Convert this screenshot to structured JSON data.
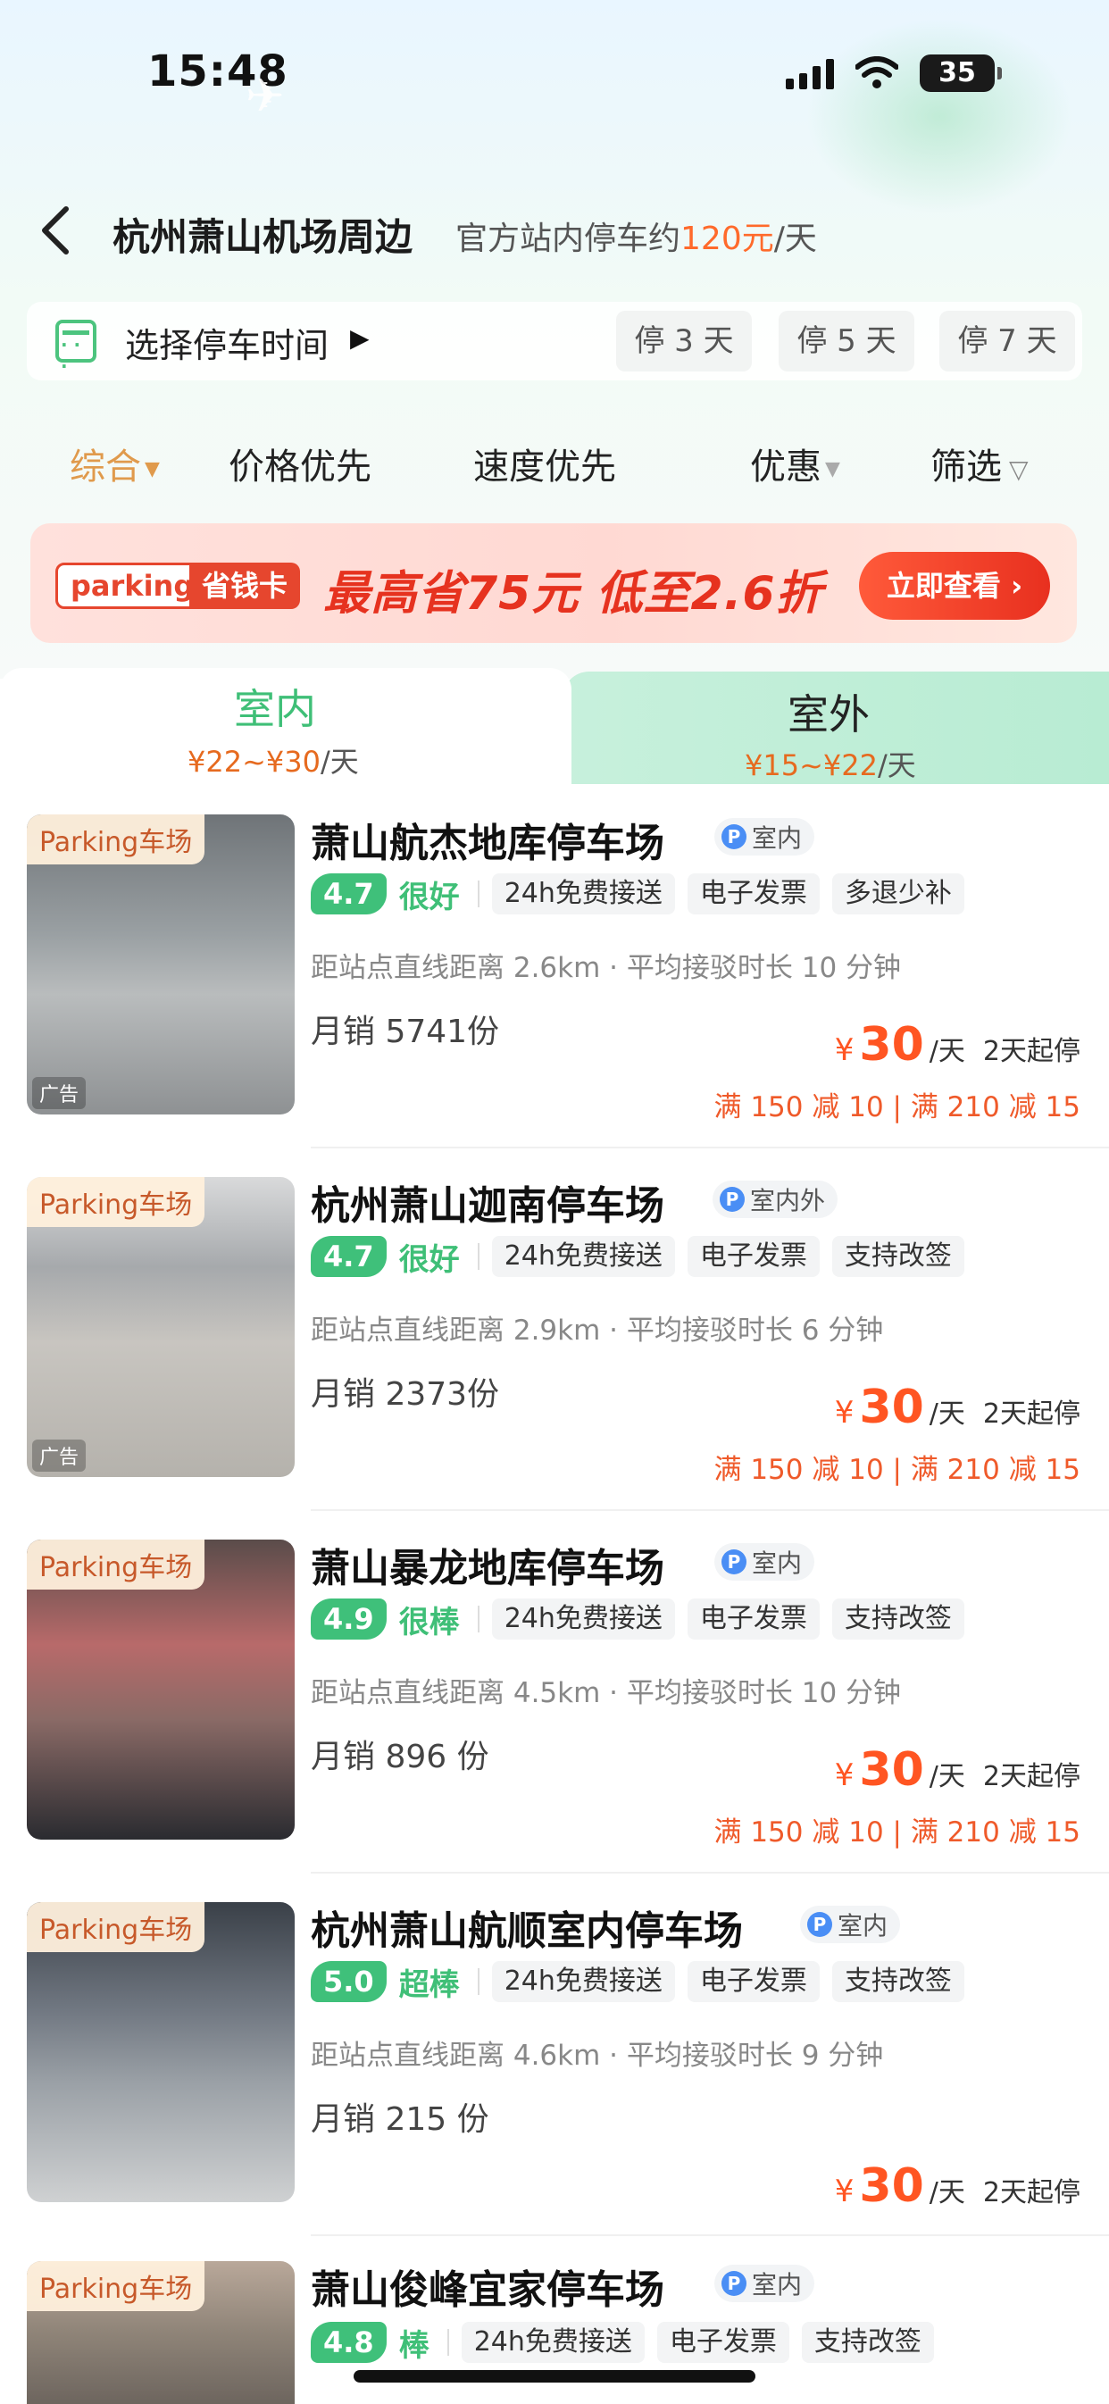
{
  "status": {
    "time": "15:48",
    "battery": "35"
  },
  "header": {
    "title": "杭州萧山机场周边",
    "subtitle_prefix": "官方站内停车约",
    "subtitle_price": "120元",
    "subtitle_suffix": "/天"
  },
  "date_picker": {
    "label": "选择停车时间",
    "chips": [
      "停 3 天",
      "停 5 天",
      "停 7 天"
    ]
  },
  "sort": {
    "items": [
      "综合",
      "价格优先",
      "速度优先",
      "优惠",
      "筛选"
    ]
  },
  "banner": {
    "tag": "parking",
    "card": "省钱卡",
    "headline": "最高省75元 低至2.6折",
    "button": "立即查看 ›"
  },
  "tabs": {
    "indoor": {
      "label": "室内",
      "range": "¥22~¥30",
      "unit": "/天"
    },
    "outdoor": {
      "label": "室外",
      "range": "¥15~¥22",
      "unit": "/天"
    }
  },
  "common": {
    "photo_tag": "Parking车场",
    "ad_tag": "广告",
    "currency": "¥",
    "price_unit": "/天"
  },
  "listings": [
    {
      "name": "萧山航杰地库停车场",
      "type": "室内",
      "score": "4.7",
      "rating": "很好",
      "features": [
        "24h免费接送",
        "电子发票",
        "多退少补"
      ],
      "distance": "距站点直线距离 2.6km · 平均接驳时长 10 分钟",
      "sales": "月销 5741份",
      "price": "30",
      "min_stay": "2天起停",
      "promo": "满 150 减 10 | 满 210 减 15",
      "ad": true
    },
    {
      "name": "杭州萧山迦南停车场",
      "type": "室内外",
      "score": "4.7",
      "rating": "很好",
      "features": [
        "24h免费接送",
        "电子发票",
        "支持改签"
      ],
      "distance": "距站点直线距离 2.9km · 平均接驳时长 6 分钟",
      "sales": "月销 2373份",
      "price": "30",
      "min_stay": "2天起停",
      "promo": "满 150 减 10 | 满 210 减 15",
      "ad": true
    },
    {
      "name": "萧山暴龙地库停车场",
      "type": "室内",
      "score": "4.9",
      "rating": "很棒",
      "features": [
        "24h免费接送",
        "电子发票",
        "支持改签"
      ],
      "distance": "距站点直线距离 4.5km · 平均接驳时长 10 分钟",
      "sales": "月销 896 份",
      "price": "30",
      "min_stay": "2天起停",
      "promo": "满 150 减 10 | 满 210 减 15",
      "ad": false
    },
    {
      "name": "杭州萧山航顺室内停车场",
      "type": "室内",
      "score": "5.0",
      "rating": "超棒",
      "features": [
        "24h免费接送",
        "电子发票",
        "支持改签"
      ],
      "distance": "距站点直线距离 4.6km · 平均接驳时长 9 分钟",
      "sales": "月销 215 份",
      "price": "30",
      "min_stay": "2天起停",
      "promo": "",
      "ad": false
    },
    {
      "name": "萧山俊峰宜家停车场",
      "type": "室内",
      "score": "4.8",
      "rating": "棒",
      "features": [
        "24h免费接送",
        "电子发票",
        "支持改签"
      ],
      "distance": "",
      "sales": "",
      "price": "",
      "min_stay": "",
      "promo": "",
      "ad": false
    }
  ],
  "colors": {
    "accent_green": "#3fc07a",
    "price_orange": "#ff5522",
    "sort_active": "#e09a4c"
  }
}
